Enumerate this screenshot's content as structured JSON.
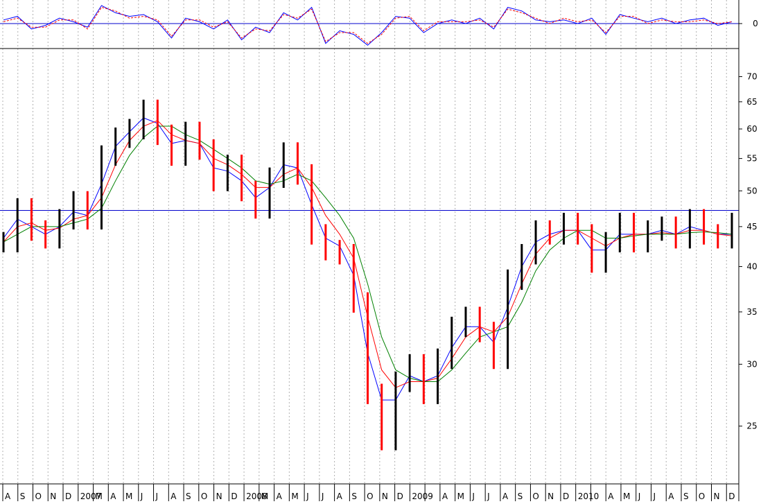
{
  "chart_data": [
    {
      "type": "line",
      "panel": "oscillator",
      "title": "",
      "xlabel": "",
      "ylabel": "",
      "y_ticks": [
        "0"
      ],
      "zero_line": 0,
      "x": [
        "2006-08",
        "2006-09",
        "2006-10",
        "2006-11",
        "2006-12",
        "2007-01",
        "2007-02",
        "2007-03",
        "2007-04",
        "2007-05",
        "2007-06",
        "2007-07",
        "2007-08",
        "2007-09",
        "2007-10",
        "2007-11",
        "2007-12",
        "2008-01",
        "2008-02",
        "2008-03",
        "2008-04",
        "2008-05",
        "2008-06",
        "2008-07",
        "2008-08",
        "2008-09",
        "2008-10",
        "2008-11",
        "2008-12",
        "2009-01",
        "2009-02",
        "2009-03",
        "2009-04",
        "2009-05",
        "2009-06",
        "2009-07",
        "2009-08",
        "2009-09",
        "2009-10",
        "2009-11",
        "2009-12",
        "2010-01",
        "2010-02",
        "2010-03",
        "2010-04",
        "2010-05",
        "2010-06",
        "2010-07",
        "2010-08",
        "2010-09",
        "2010-10",
        "2010-11",
        "2010-12"
      ],
      "series": [
        {
          "color": "#0000ff",
          "values": [
            0.2,
            0.4,
            -0.3,
            -0.1,
            0.3,
            0.1,
            -0.2,
            1.0,
            0.6,
            0.4,
            0.5,
            0.1,
            -0.8,
            0.3,
            0.1,
            -0.3,
            0.2,
            -0.9,
            -0.2,
            -0.5,
            0.6,
            0.2,
            0.9,
            -1.1,
            -0.4,
            -0.6,
            -1.2,
            -0.5,
            0.4,
            0.3,
            -0.5,
            0.0,
            0.2,
            0.0,
            0.3,
            -0.3,
            0.9,
            0.7,
            0.2,
            0.1,
            0.2,
            0.0,
            0.3,
            -0.6,
            0.5,
            0.3,
            0.1,
            0.3,
            0.0,
            0.2,
            0.3,
            -0.1,
            0.1
          ]
        },
        {
          "color": "#ff0000",
          "values": [
            0.1,
            0.3,
            -0.2,
            -0.2,
            0.2,
            0.2,
            -0.3,
            0.9,
            0.7,
            0.3,
            0.4,
            0.2,
            -0.7,
            0.2,
            0.2,
            -0.2,
            0.1,
            -0.8,
            -0.3,
            -0.4,
            0.5,
            0.3,
            0.8,
            -1.0,
            -0.5,
            -0.5,
            -1.1,
            -0.6,
            0.3,
            0.4,
            -0.4,
            0.1,
            0.1,
            0.1,
            0.2,
            -0.2,
            0.8,
            0.6,
            0.3,
            0.0,
            0.3,
            0.1,
            0.2,
            -0.5,
            0.4,
            0.4,
            0.0,
            0.2,
            0.1,
            0.1,
            0.2,
            0.0,
            0.1
          ]
        }
      ]
    },
    {
      "type": "line",
      "panel": "price",
      "title": "",
      "xlabel": "",
      "ylabel": "",
      "y_scale": "log",
      "y_ticks": [
        "25",
        "30",
        "35",
        "40",
        "45",
        "50",
        "55",
        "60",
        "65",
        "70"
      ],
      "ylim": [
        21,
        73
      ],
      "x_tick_labels": [
        "A",
        "S",
        "O",
        "N",
        "D",
        "2007",
        "M",
        "A",
        "M",
        "J",
        "J",
        "A",
        "S",
        "O",
        "N",
        "D",
        "2008",
        "M",
        "A",
        "M",
        "J",
        "J",
        "A",
        "S",
        "O",
        "N",
        "D",
        "2009",
        "",
        "A",
        "M",
        "J",
        "J",
        "A",
        "S",
        "O",
        "N",
        "D",
        "2010",
        "",
        "A",
        "M",
        "J",
        "J",
        "A",
        "S",
        "O",
        "N",
        "D"
      ],
      "horizontal_line": 47.2,
      "x": [
        "2006-08",
        "2006-09",
        "2006-10",
        "2006-11",
        "2006-12",
        "2007-01",
        "2007-02",
        "2007-03",
        "2007-04",
        "2007-05",
        "2007-06",
        "2007-07",
        "2007-08",
        "2007-09",
        "2007-10",
        "2007-11",
        "2007-12",
        "2008-01",
        "2008-02",
        "2008-03",
        "2008-04",
        "2008-05",
        "2008-06",
        "2008-07",
        "2008-08",
        "2008-09",
        "2008-10",
        "2008-11",
        "2008-12",
        "2009-01",
        "2009-02",
        "2009-03",
        "2009-04",
        "2009-05",
        "2009-06",
        "2009-07",
        "2009-08",
        "2009-09",
        "2009-10",
        "2009-11",
        "2009-12",
        "2010-01",
        "2010-02",
        "2010-03",
        "2010-04",
        "2010-05",
        "2010-06",
        "2010-07",
        "2010-08",
        "2010-09",
        "2010-10",
        "2010-11",
        "2010-12"
      ],
      "series": [
        {
          "name": "",
          "color": "#ff0000",
          "role": "price",
          "values": [
            43.0,
            47.5,
            44.5,
            43.5,
            46.0,
            48.5,
            46.0,
            55.5,
            58.5,
            60.0,
            63.5,
            59.0,
            55.5,
            59.5,
            56.5,
            51.5,
            54.0,
            50.0,
            47.5,
            52.0,
            56.0,
            52.5,
            44.0,
            42.0,
            41.5,
            36.0,
            27.5,
            24.0,
            28.5,
            30.0,
            27.5,
            30.5,
            33.5,
            34.5,
            33.0,
            30.5,
            38.5,
            41.5,
            44.5,
            44.0,
            45.5,
            44.0,
            40.5,
            43.0,
            45.5,
            43.0,
            44.5,
            45.0,
            43.5,
            46.0,
            44.0,
            43.5,
            45.5
          ]
        },
        {
          "name": "",
          "color": "#0000ff",
          "role": "ma-short",
          "values": [
            43.5,
            46.0,
            45.0,
            44.0,
            45.0,
            47.0,
            46.5,
            51.0,
            57.0,
            59.5,
            62.0,
            61.0,
            57.5,
            58.0,
            57.5,
            53.5,
            53.0,
            51.5,
            49.0,
            50.5,
            54.0,
            53.5,
            48.0,
            43.5,
            42.5,
            39.0,
            31.0,
            27.0,
            27.0,
            29.0,
            28.5,
            29.0,
            31.5,
            33.5,
            33.5,
            32.0,
            35.5,
            40.0,
            43.0,
            44.0,
            44.5,
            44.5,
            42.0,
            42.0,
            44.0,
            44.0,
            44.0,
            44.5,
            44.0,
            45.0,
            44.5,
            44.0,
            44.0
          ]
        },
        {
          "name": "",
          "color": "#ff0000",
          "role": "ma-medium",
          "values": [
            43.0,
            45.0,
            45.5,
            44.5,
            44.8,
            46.0,
            46.5,
            49.0,
            54.0,
            58.0,
            60.5,
            61.5,
            59.0,
            58.0,
            57.5,
            55.0,
            54.0,
            52.5,
            50.5,
            50.5,
            52.5,
            53.5,
            50.5,
            46.5,
            44.0,
            41.0,
            34.5,
            29.5,
            28.0,
            28.5,
            28.5,
            28.8,
            30.5,
            32.5,
            33.5,
            33.0,
            34.5,
            38.0,
            41.5,
            43.5,
            44.5,
            44.5,
            43.5,
            42.5,
            43.5,
            44.0,
            44.0,
            44.2,
            44.0,
            44.5,
            44.5,
            44.0,
            43.8
          ]
        },
        {
          "name": "",
          "color": "#008000",
          "role": "ma-long",
          "values": [
            43.0,
            44.0,
            45.0,
            45.0,
            45.0,
            45.5,
            46.0,
            47.5,
            51.5,
            55.5,
            58.5,
            60.5,
            60.5,
            59.0,
            58.0,
            56.5,
            55.0,
            53.5,
            51.5,
            51.0,
            51.5,
            52.5,
            51.5,
            49.0,
            46.5,
            43.5,
            38.0,
            32.5,
            29.5,
            28.8,
            28.5,
            28.5,
            29.5,
            31.0,
            32.5,
            33.0,
            33.5,
            36.0,
            39.5,
            42.0,
            43.5,
            44.5,
            44.5,
            43.5,
            43.5,
            43.8,
            44.0,
            44.0,
            44.0,
            44.2,
            44.3,
            44.2,
            44.0
          ]
        }
      ]
    }
  ]
}
